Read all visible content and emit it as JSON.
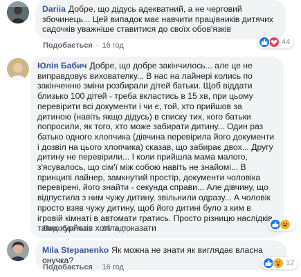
{
  "comments": [
    {
      "author": "Dariia",
      "text": "Добре, що дідусь адекватний, а не черговий збочинець... Цей випадок має навчити працівників дитячих садочків уважніше ставитися до своїх обов'язків",
      "like_label": "Подобається",
      "time": "16 год",
      "reaction_count": "44",
      "reactions": [
        "like-icon",
        "love-icon"
      ]
    },
    {
      "author": "Юлія Бабич",
      "text": "Добре, що добре закінчилось... але це не виправдовує вихователку... В нас на лайнері колись по закінченню зміни розбирали дітей батьки. Щоб віддати близько 100 дітей - треба вкластись в 15 хв, при цьому перевірити всі документи і чи є, той, хто прийшов за дитиною (навіть якщо дідусь) в списку тих, кого батьки попросили, як того, хто може забирати дитину... Один раз батько одного хлопчика (дівчина перевірила його документи і дозвіл на цього хлопчика) сказав, що забирає двох... Другу дитину не перевірили... І коли прийшла мама малого, з'ясувалось, що сім'ї між собою навіть не знайомі... В принципі лайнер, замкнутий простір, документи чоловіка перевірені, його знайти - секунда справи... Але дівчину, що відпустила з ним чужу дитину, звільнили одразу... А чоловік просто взяв чужу дитину, щоб його дитині було з ким в ігровій кімнаті в автомати гратись. Просто різницю наслідків таких курйозів хотіла показати",
      "like_label": "Подобається",
      "time": "16 год",
      "reaction_count": "",
      "reactions": [
        "like-icon",
        "haha-icon"
      ]
    },
    {
      "author": "Mila Stepanenko",
      "text": "Як можна не знати як виглядає власна онучка?",
      "like_label": "Подобається",
      "time": "16 год",
      "reaction_count": "12",
      "reactions": [
        "like-icon",
        "wow-icon"
      ]
    }
  ],
  "colors": {
    "author": "#385898",
    "bubble": "#f2f3f5",
    "like_blue": "#1877f2",
    "love_red": "#f33e58",
    "haha_yellow": "#f7b125"
  }
}
